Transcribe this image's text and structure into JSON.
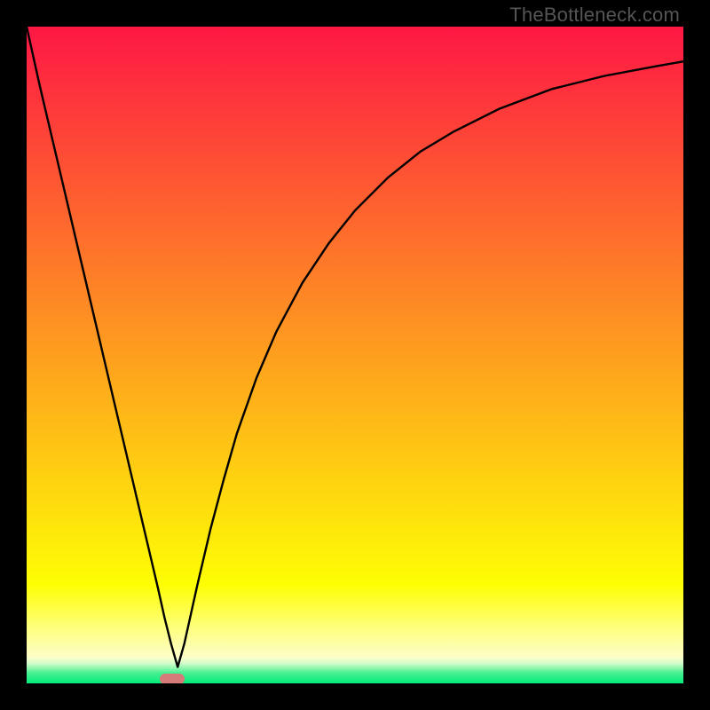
{
  "watermark": {
    "text": "TheBottleneck.com"
  },
  "colors": {
    "black": "#000000",
    "curve": "#000000",
    "marker": "#d77a7a",
    "watermark": "#555557"
  },
  "chart_data": {
    "type": "line",
    "title": "",
    "xlabel": "",
    "ylabel": "",
    "xlim": [
      0,
      100
    ],
    "ylim": [
      0,
      100
    ],
    "gradient_bands": [
      {
        "y0": 0.0,
        "y1": 85.0,
        "top": "#fe1744",
        "bottom": "#fefe04"
      },
      {
        "y0": 85.0,
        "y1": 91.0,
        "top": "#fefe04",
        "bottom": "#feff74"
      },
      {
        "y0": 91.0,
        "y1": 96.0,
        "top": "#feff74",
        "bottom": "#fdfeca"
      },
      {
        "y0": 96.0,
        "y1": 97.0,
        "top": "#fdfeca",
        "bottom": "#d0fcca"
      },
      {
        "y0": 97.0,
        "y1": 98.3,
        "top": "#d0fcca",
        "bottom": "#4cf193"
      },
      {
        "y0": 98.3,
        "y1": 100.0,
        "top": "#4cf193",
        "bottom": "#00eb79"
      }
    ],
    "series": [
      {
        "name": "bottleneck-curve",
        "x": [
          0.0,
          2,
          4,
          6,
          8,
          10,
          12,
          14,
          16,
          18,
          20,
          21,
          22,
          23,
          24,
          26,
          28,
          30,
          32,
          35,
          38,
          42,
          46,
          50,
          55,
          60,
          65,
          72,
          80,
          88,
          96,
          100
        ],
        "y": [
          100,
          91,
          82.5,
          74,
          65.5,
          57,
          48.5,
          40,
          31.5,
          23,
          14.5,
          10,
          6,
          2.5,
          6,
          15,
          23.5,
          31,
          38,
          46.5,
          53.5,
          61,
          67,
          72,
          77,
          81,
          84,
          87.5,
          90.5,
          92.5,
          94,
          94.7
        ]
      }
    ],
    "marker": {
      "x": 22.2,
      "y": 0.7,
      "w": 3.8,
      "h": 1.6
    }
  }
}
